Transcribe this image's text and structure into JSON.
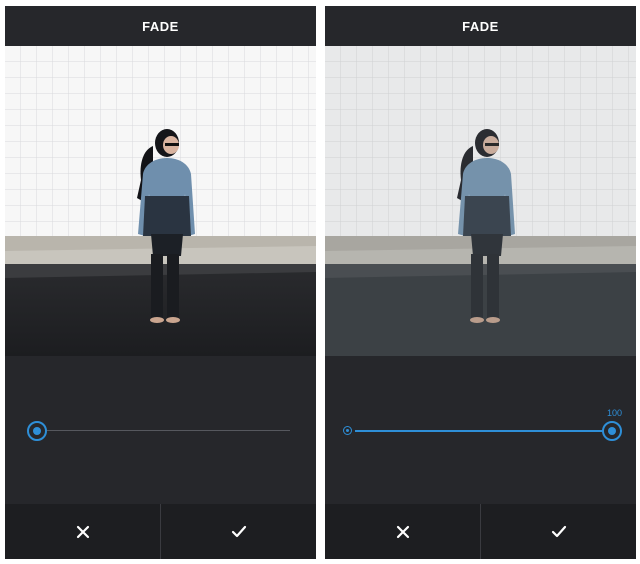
{
  "panels": [
    {
      "header": {
        "title": "FADE"
      },
      "slider": {
        "value": 0,
        "value_label": ""
      },
      "footer": {
        "cancel_icon": "close-icon",
        "confirm_icon": "checkmark-icon"
      }
    },
    {
      "header": {
        "title": "FADE"
      },
      "slider": {
        "value": 100,
        "value_label": "100"
      },
      "footer": {
        "cancel_icon": "close-icon",
        "confirm_icon": "checkmark-icon"
      }
    }
  ],
  "colors": {
    "accent": "#2e8fd8",
    "panel_background": "#26272b",
    "footer_background": "#1d1e21"
  }
}
